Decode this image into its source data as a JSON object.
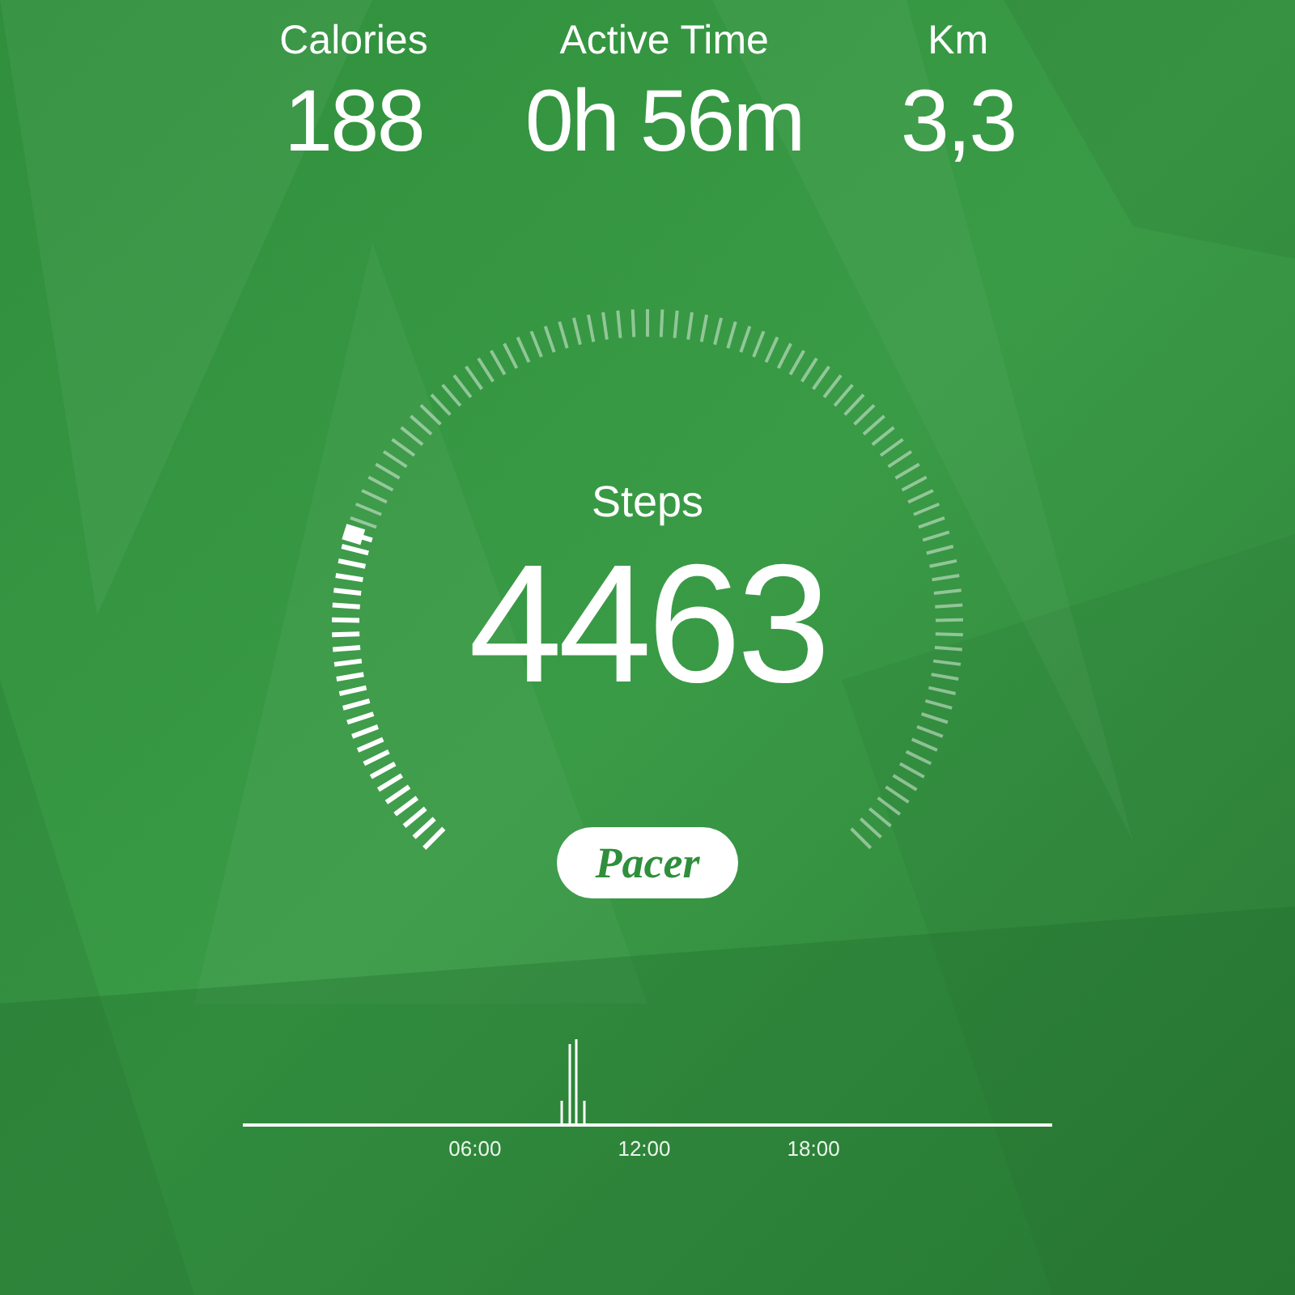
{
  "stats": [
    {
      "label": "Calories",
      "value": "188"
    },
    {
      "label": "Active Time",
      "value": "0h 56m"
    },
    {
      "label": "Km",
      "value": "3,3"
    }
  ],
  "steps": {
    "label": "Steps",
    "value": "4463"
  },
  "brand": {
    "label": "Pacer"
  },
  "timeline": {
    "ticks": [
      "06:00",
      "12:00",
      "18:00"
    ]
  }
}
